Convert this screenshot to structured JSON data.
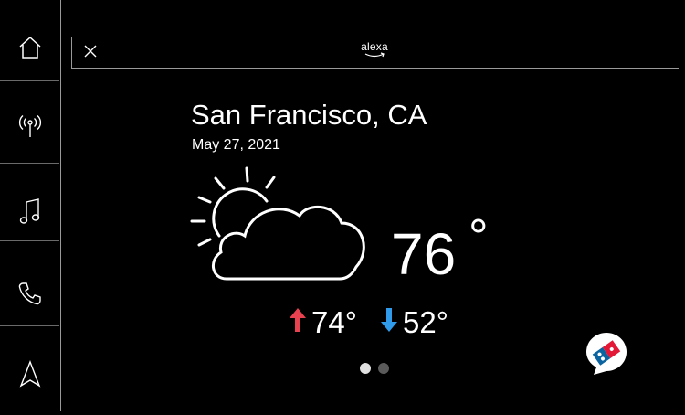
{
  "nav": {
    "items": [
      {
        "name": "home",
        "icon": "home-icon"
      },
      {
        "name": "radio",
        "icon": "radio-icon"
      },
      {
        "name": "music",
        "icon": "music-note-icon"
      },
      {
        "name": "phone",
        "icon": "phone-icon"
      },
      {
        "name": "navigation",
        "icon": "navigation-arrow-icon"
      }
    ]
  },
  "header": {
    "brand": "alexa",
    "close_icon": "close-icon"
  },
  "weather": {
    "city": "San Francisco, CA",
    "date": "May 27, 2021",
    "condition_icon": "partly-cloudy-icon",
    "current_temp": "76",
    "degree_symbol": "°",
    "high": "74°",
    "low": "52°"
  },
  "pagination": {
    "total": 2,
    "active": 1
  },
  "skill": {
    "icon": "dominos-skill-icon"
  },
  "colors": {
    "background": "#000000",
    "text": "#ffffff",
    "high_arrow": "#e8414f",
    "low_arrow": "#2f9bea",
    "divider": "#9a9a9a",
    "dominos_blue": "#0b64a0",
    "dominos_red": "#e31837"
  }
}
